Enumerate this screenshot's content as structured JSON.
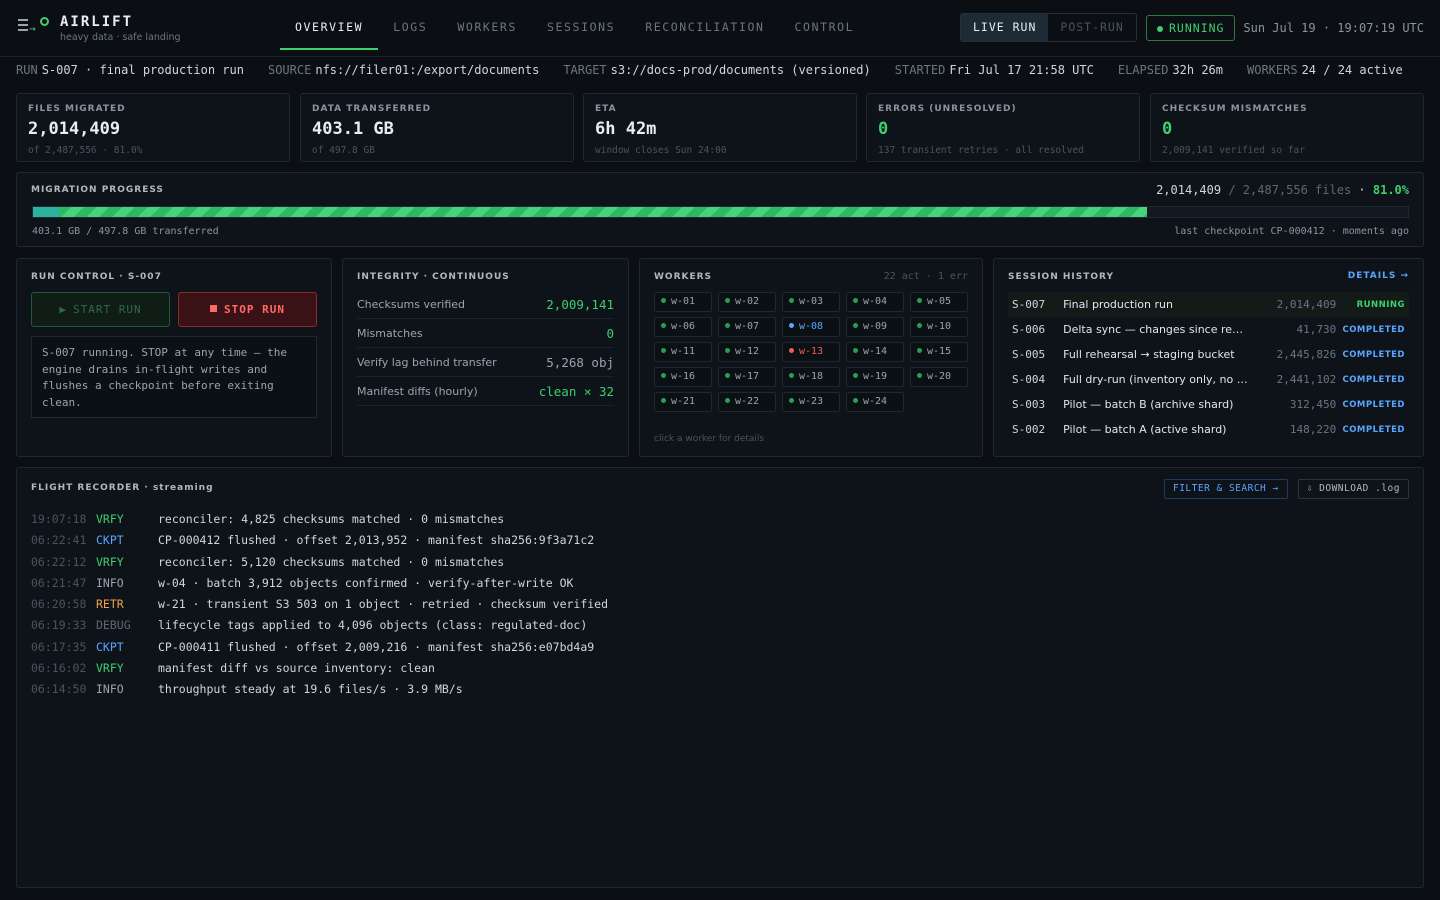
{
  "app": {
    "name": "AIRLIFT",
    "tagline": "heavy data · safe landing"
  },
  "nav": {
    "tabs": [
      "OVERVIEW",
      "LOGS",
      "WORKERS",
      "SESSIONS",
      "RECONCILIATION",
      "CONTROL"
    ],
    "active": "OVERVIEW"
  },
  "mode": {
    "live": "LIVE RUN",
    "post": "POST-RUN"
  },
  "status": {
    "badge": "RUNNING",
    "clock": "Sun Jul 19 · 19:07:19 UTC"
  },
  "run_info": {
    "run_label": "RUN",
    "run_value": "S-007 · final production run",
    "source_label": "SOURCE",
    "source_value": "nfs://filer01:/export/documents",
    "target_label": "TARGET",
    "target_value": "s3://docs-prod/documents (versioned)",
    "started_label": "STARTED",
    "started_value": "Fri Jul 17 21:58 UTC",
    "elapsed_label": "ELAPSED",
    "elapsed_value": "32h 26m",
    "workers_label": "WORKERS",
    "workers_value": "24 / 24 active"
  },
  "stats": [
    {
      "title": "FILES MIGRATED",
      "value": "2,014,409",
      "sub": "of 2,487,556 · 81.0%"
    },
    {
      "title": "DATA TRANSFERRED",
      "value": "403.1 GB",
      "sub": "of 497.8 GB"
    },
    {
      "title": "ETA",
      "value": "6h 42m",
      "sub": "window closes Sun 24:00"
    },
    {
      "title": "ERRORS (UNRESOLVED)",
      "value": "0",
      "sub": "137 transient retries · all resolved"
    },
    {
      "title": "CHECKSUM MISMATCHES",
      "value": "0",
      "sub": "2,009,141 verified so far"
    }
  ],
  "progress": {
    "title": "MIGRATION PROGRESS",
    "done": "2,014,409",
    "total": "/ 2,487,556 files",
    "sep": "·",
    "percent": "81.0%",
    "fraction": 0.81,
    "transferred": "403.1 GB / 497.8 GB transferred",
    "checkpoint": "last checkpoint CP-000412 · moments ago"
  },
  "run_control": {
    "title": "RUN CONTROL · S-007",
    "start_label": "START RUN",
    "stop_label": "STOP RUN",
    "note": "S-007 running. STOP at any time — the engine drains in-flight writes and flushes a checkpoint before exiting clean."
  },
  "integrity": {
    "title": "INTEGRITY · CONTINUOUS",
    "rows": [
      {
        "label": "Checksums verified",
        "value": "2,009,141"
      },
      {
        "label": "Mismatches",
        "value": "0"
      },
      {
        "label": "Verify lag behind transfer",
        "value": "5,268 obj"
      },
      {
        "label": "Manifest diffs (hourly)",
        "value": "clean × 32"
      }
    ]
  },
  "workers": {
    "title": "WORKERS",
    "meta": "22 act · 1 err",
    "hint": "click a worker for details",
    "list": [
      {
        "id": "w-01",
        "state": "ok"
      },
      {
        "id": "w-02",
        "state": "ok"
      },
      {
        "id": "w-03",
        "state": "ok"
      },
      {
        "id": "w-04",
        "state": "ok"
      },
      {
        "id": "w-05",
        "state": "ok"
      },
      {
        "id": "w-06",
        "state": "ok"
      },
      {
        "id": "w-07",
        "state": "ok"
      },
      {
        "id": "w-08",
        "state": "idle"
      },
      {
        "id": "w-09",
        "state": "ok"
      },
      {
        "id": "w-10",
        "state": "ok"
      },
      {
        "id": "w-11",
        "state": "ok"
      },
      {
        "id": "w-12",
        "state": "ok"
      },
      {
        "id": "w-13",
        "state": "err"
      },
      {
        "id": "w-14",
        "state": "ok"
      },
      {
        "id": "w-15",
        "state": "ok"
      },
      {
        "id": "w-16",
        "state": "ok"
      },
      {
        "id": "w-17",
        "state": "ok"
      },
      {
        "id": "w-18",
        "state": "ok"
      },
      {
        "id": "w-19",
        "state": "ok"
      },
      {
        "id": "w-20",
        "state": "ok"
      },
      {
        "id": "w-21",
        "state": "ok"
      },
      {
        "id": "w-22",
        "state": "ok"
      },
      {
        "id": "w-23",
        "state": "ok"
      },
      {
        "id": "w-24",
        "state": "ok"
      }
    ]
  },
  "sessions": {
    "title": "SESSION HISTORY",
    "details": "DETAILS →",
    "rows": [
      {
        "id": "S-007",
        "name": "Final production run",
        "count": "2,014,409",
        "status": "RUNNING"
      },
      {
        "id": "S-006",
        "name": "Delta sync — changes since rehearsal",
        "count": "41,730",
        "status": "COMPLETED"
      },
      {
        "id": "S-005",
        "name": "Full rehearsal → staging bucket",
        "count": "2,445,826",
        "status": "COMPLETED"
      },
      {
        "id": "S-004",
        "name": "Full dry-run (inventory only, no wri...",
        "count": "2,441,102",
        "status": "COMPLETED"
      },
      {
        "id": "S-003",
        "name": "Pilot — batch B (archive shard)",
        "count": "312,450",
        "status": "COMPLETED"
      },
      {
        "id": "S-002",
        "name": "Pilot — batch A (active shard)",
        "count": "148,220",
        "status": "COMPLETED"
      }
    ]
  },
  "flight": {
    "title_main": "FLIGHT RECORDER",
    "title_sub": "· streaming",
    "filter": "FILTER & SEARCH →",
    "download": "⇩ DOWNLOAD .log",
    "rows": [
      {
        "ts": "19:07:18",
        "lv": "VRFY",
        "msg": "reconciler: 4,825 checksums matched · 0 mismatches"
      },
      {
        "ts": "06:22:41",
        "lv": "CKPT",
        "msg": "CP-000412 flushed · offset 2,013,952 · manifest sha256:9f3a71c2"
      },
      {
        "ts": "06:22:12",
        "lv": "VRFY",
        "msg": "reconciler: 5,120 checksums matched · 0 mismatches"
      },
      {
        "ts": "06:21:47",
        "lv": "INFO",
        "msg": "w-04 · batch 3,912 objects confirmed · verify-after-write OK"
      },
      {
        "ts": "06:20:58",
        "lv": "RETR",
        "msg": "w-21 · transient S3 503 on 1 object · retried · checksum verified"
      },
      {
        "ts": "06:19:33",
        "lv": "DEBUG",
        "msg": "lifecycle tags applied to 4,096 objects (class: regulated-doc)"
      },
      {
        "ts": "06:17:35",
        "lv": "CKPT",
        "msg": "CP-000411 flushed · offset 2,009,216 · manifest sha256:e07bd4a9"
      },
      {
        "ts": "06:16:02",
        "lv": "VRFY",
        "msg": "manifest diff vs source inventory: clean"
      },
      {
        "ts": "06:14:50",
        "lv": "INFO",
        "msg": "throughput steady at 19.6 files/s · 3.9 MB/s"
      }
    ]
  },
  "colors": {
    "accent": "#3ecf6e",
    "info": "#58a6ff",
    "error": "#f25c54",
    "warn": "#f0a04b",
    "bg": "#0b0f14"
  }
}
